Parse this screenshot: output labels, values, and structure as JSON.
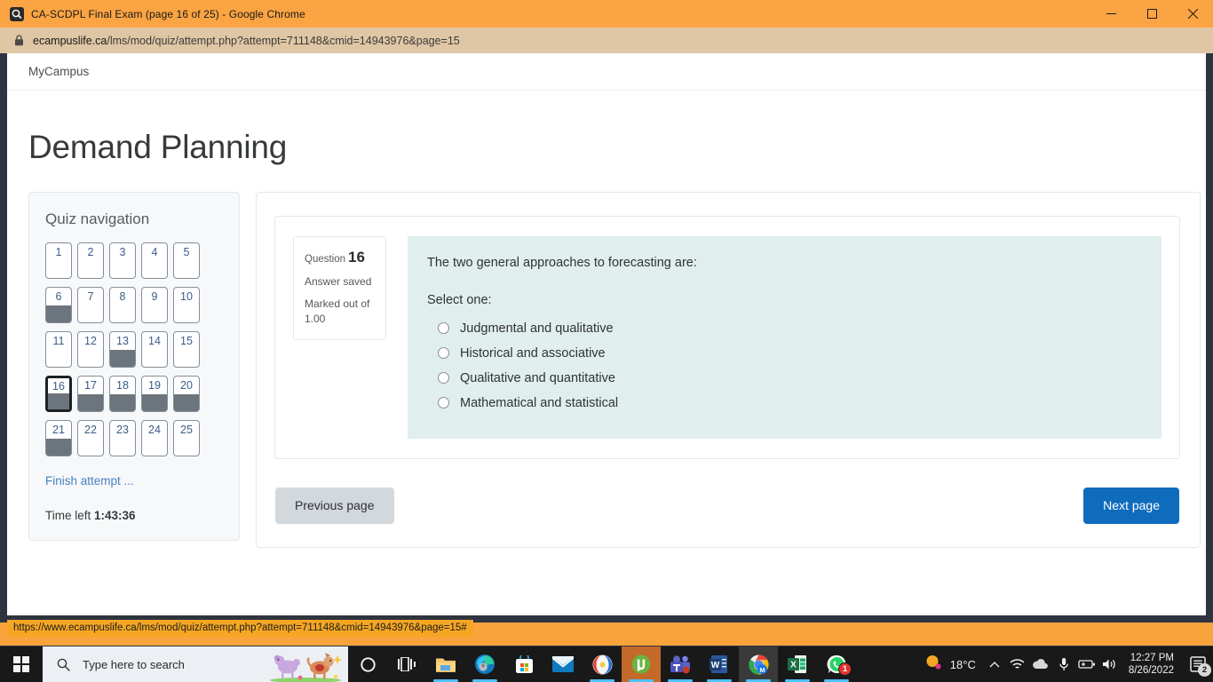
{
  "browser": {
    "window_title": "CA-SCDPL Final Exam (page 16 of 25) - Google Chrome",
    "favicon_name": "site-favicon",
    "minimize_label": "Minimize",
    "maximize_label": "Maximize",
    "close_label": "Close",
    "url_domain": "ecampuslife.ca",
    "url_path": "/lms/mod/quiz/attempt.php?attempt=711148&cmid=14943976&page=15",
    "lock_icon": "lock-icon",
    "status_url": "https://www.ecampuslife.ca/lms/mod/quiz/attempt.php?attempt=711148&cmid=14943976&page=15#"
  },
  "site": {
    "brand": "MyCampus",
    "page_title": "Demand Planning"
  },
  "quiz_navigation": {
    "heading": "Quiz navigation",
    "buttons": [
      {
        "label": "1",
        "state": "notyetanswered",
        "current": false
      },
      {
        "label": "2",
        "state": "notyetanswered",
        "current": false
      },
      {
        "label": "3",
        "state": "notyetanswered",
        "current": false
      },
      {
        "label": "4",
        "state": "notyetanswered",
        "current": false
      },
      {
        "label": "5",
        "state": "notyetanswered",
        "current": false
      },
      {
        "label": "6",
        "state": "answered",
        "current": false
      },
      {
        "label": "7",
        "state": "notyetanswered",
        "current": false
      },
      {
        "label": "8",
        "state": "notyetanswered",
        "current": false
      },
      {
        "label": "9",
        "state": "notyetanswered",
        "current": false
      },
      {
        "label": "10",
        "state": "notyetanswered",
        "current": false
      },
      {
        "label": "11",
        "state": "notyetanswered",
        "current": false
      },
      {
        "label": "12",
        "state": "notyetanswered",
        "current": false
      },
      {
        "label": "13",
        "state": "answered",
        "current": false
      },
      {
        "label": "14",
        "state": "notyetanswered",
        "current": false
      },
      {
        "label": "15",
        "state": "notyetanswered",
        "current": false
      },
      {
        "label": "16",
        "state": "answered",
        "current": true
      },
      {
        "label": "17",
        "state": "answered",
        "current": false
      },
      {
        "label": "18",
        "state": "answered",
        "current": false
      },
      {
        "label": "19",
        "state": "answered",
        "current": false
      },
      {
        "label": "20",
        "state": "answered",
        "current": false
      },
      {
        "label": "21",
        "state": "answered",
        "current": false
      },
      {
        "label": "22",
        "state": "notyetanswered",
        "current": false
      },
      {
        "label": "23",
        "state": "notyetanswered",
        "current": false
      },
      {
        "label": "24",
        "state": "notyetanswered",
        "current": false
      },
      {
        "label": "25",
        "state": "notyetanswered",
        "current": false
      }
    ],
    "finish_attempt": "Finish attempt ...",
    "time_left_label": "Time left ",
    "time_left_value": "1:43:36"
  },
  "question": {
    "number_label": "Question",
    "number": "16",
    "state": "Answer saved",
    "marked_out_of": "Marked out of 1.00",
    "text": "The two general approaches to forecasting are:",
    "select_one": "Select one:",
    "options": [
      {
        "label": "Judgmental and qualitative",
        "selected": false
      },
      {
        "label": "Historical and associative",
        "selected": false
      },
      {
        "label": "Qualitative and quantitative",
        "selected": false
      },
      {
        "label": "Mathematical and statistical",
        "selected": false
      }
    ]
  },
  "navigation_buttons": {
    "previous": "Previous page",
    "next": "Next page",
    "next_color": "#0f6cbd",
    "previous_color": "#d3d8dc"
  },
  "taskbar": {
    "start_label": "Start",
    "search_placeholder": "Type here to search",
    "search_icon": "search-icon",
    "items": [
      {
        "name": "cortana-icon",
        "state": "idle"
      },
      {
        "name": "task-view-icon",
        "state": "idle"
      },
      {
        "name": "file-explorer-icon",
        "state": "running"
      },
      {
        "name": "microsoft-edge-icon",
        "state": "running"
      },
      {
        "name": "microsoft-store-icon",
        "state": "idle"
      },
      {
        "name": "mail-icon",
        "state": "idle"
      },
      {
        "name": "opera-icon",
        "state": "running"
      },
      {
        "name": "utorrent-icon",
        "state": "active"
      },
      {
        "name": "microsoft-teams-icon",
        "state": "running"
      },
      {
        "name": "microsoft-word-icon",
        "state": "running"
      },
      {
        "name": "google-chrome-icon",
        "state": "focused"
      },
      {
        "name": "microsoft-excel-icon",
        "state": "running"
      },
      {
        "name": "whatsapp-icon",
        "state": "running",
        "badge": "1"
      }
    ],
    "weather": {
      "icon": "sunny-icon",
      "temperature": "18°C"
    },
    "tray": [
      "chevron-up-icon",
      "wifi-icon",
      "onedrive-icon",
      "microphone-icon",
      "battery-icon",
      "volume-icon"
    ],
    "clock_time": "12:27 PM",
    "clock_date": "8/26/2022",
    "action_center_icon": "action-center-icon",
    "action_center_badge": "2"
  }
}
